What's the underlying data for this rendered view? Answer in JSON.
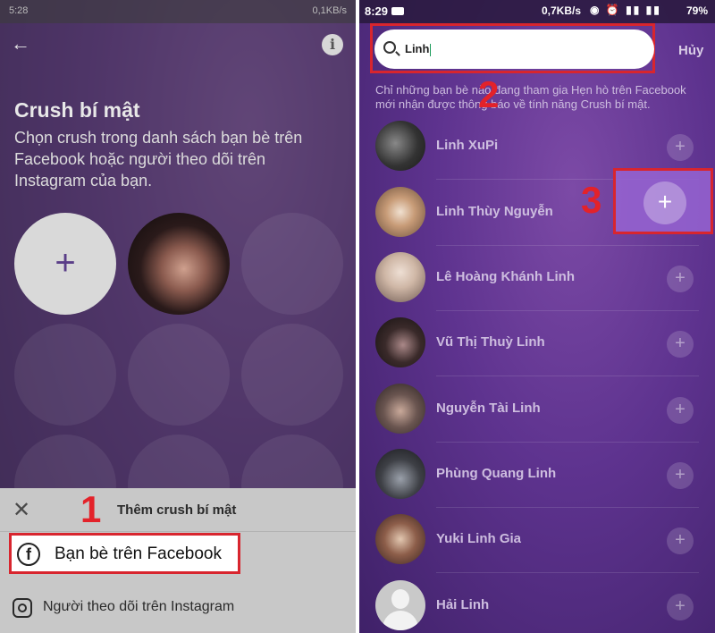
{
  "left": {
    "status_left": "5:28",
    "status_right": "0,1KB/s",
    "back_icon": "back-arrow-icon",
    "title": "Crush bí mật",
    "description": "Chọn crush trong danh sách bạn bè trên Facebook hoặc người theo dõi trên Instagram của bạn.",
    "sheet": {
      "title": "Thêm crush bí mật",
      "facebook_label": "Bạn bè trên Facebook",
      "instagram_label": "Người theo dõi trên Instagram"
    },
    "step_label": "1"
  },
  "right": {
    "status": {
      "time": "8:29",
      "speed": "0,7KB/s",
      "battery": "79%"
    },
    "search": {
      "value": "Linh"
    },
    "cancel_label": "Hủy",
    "notice": "Chỉ những bạn bè nào đang tham gia Hẹn hò trên Facebook mới nhận được thông báo về tính năng Crush bí mật.",
    "results": [
      {
        "name": "Linh XuPi"
      },
      {
        "name": "Linh Thùy Nguyễn"
      },
      {
        "name": "Lê Hoàng Khánh Linh"
      },
      {
        "name": "Vũ Thị Thuỳ Linh"
      },
      {
        "name": "Nguyễn Tài Linh"
      },
      {
        "name": "Phùng Quang Linh"
      },
      {
        "name": "Yuki Linh Gia"
      },
      {
        "name": "Hải Linh"
      }
    ],
    "step2_label": "2",
    "step3_label": "3",
    "add_symbol": "+"
  },
  "colors": {
    "accent_red": "#d8252e",
    "purple": "#5e338f"
  }
}
